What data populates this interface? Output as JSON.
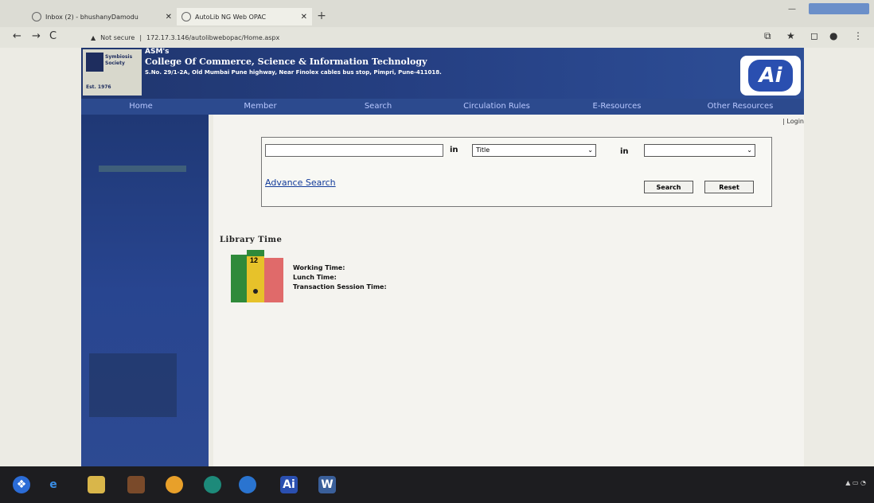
{
  "browser": {
    "tabs": [
      {
        "title": "Inbox (2) - bhushanyDamodu"
      },
      {
        "title": "AutoLib NG Web OPAC"
      }
    ],
    "address": {
      "security": "Not secure",
      "url": "172.17.3.146/autolibwebopac/Home.aspx"
    }
  },
  "header": {
    "logo_text": "Symbiosis Society",
    "logo_subtext": "Est. 1976",
    "inst_short": "ASM's",
    "inst_name": "College Of Commerce, Science & Information Technology",
    "inst_address": "S.No. 29/1-2A, Old Mumbai Pune highway, Near Finolex cables bus stop, Pimpri, Pune-411018.",
    "brand_mark": "Ai"
  },
  "menu": [
    "Home",
    "Member",
    "Search",
    "Circulation Rules",
    "E-Resources",
    "Other Resources"
  ],
  "content": {
    "login_link": "| Login",
    "search": {
      "in_label_1": "in",
      "field_selected": "Title",
      "in_label_2": "in",
      "collection_selected": "",
      "advance_link": "Advance Search",
      "search_button": "Search",
      "reset_button": "Reset"
    },
    "library_time": {
      "heading": "Library Time",
      "working": "Working Time:",
      "lunch": "Lunch Time:",
      "session": "Transaction Session Time:"
    }
  },
  "colors": {
    "banner": "#20366e",
    "menu": "#2c4a8e",
    "sidebar": "#284590",
    "brand": "#2a4fb0"
  }
}
